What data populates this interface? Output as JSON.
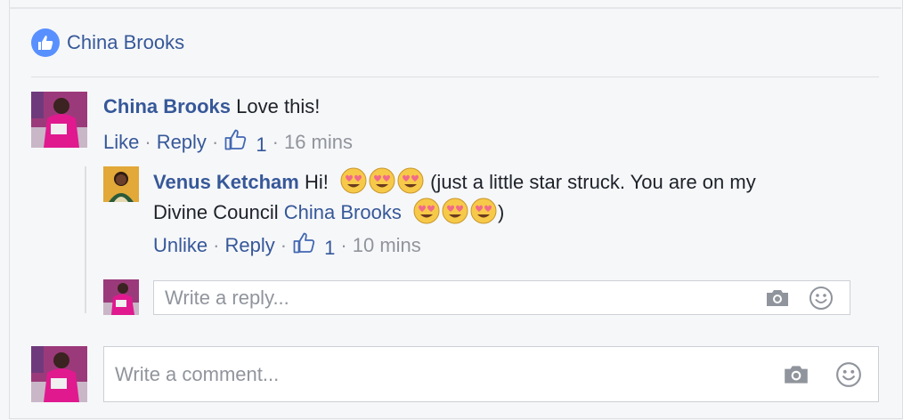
{
  "likes_summary": {
    "name": "China Brooks"
  },
  "comments": [
    {
      "author": "China Brooks",
      "text": "Love this!",
      "actions": {
        "like": "Like",
        "reply": "Reply",
        "like_count": "1",
        "time": "16 mins"
      }
    }
  ],
  "reply": {
    "author": "Venus Ketcham",
    "text_part1": "Hi!",
    "text_part2": "(just a little star struck. You are on my",
    "text_part3": "Divine Council",
    "mention": "China Brooks",
    "text_part4": ")",
    "emoji": "smiling-face-with-heart-eyes",
    "actions": {
      "unlike": "Unlike",
      "reply": "Reply",
      "like_count": "1",
      "time": "10 mins"
    }
  },
  "reply_input": {
    "placeholder": "Write a reply..."
  },
  "comment_input": {
    "placeholder": "Write a comment..."
  },
  "separator": "·",
  "colors": {
    "link": "#365899",
    "meta": "#90949c",
    "like_blue": "#5890ff",
    "background": "#f6f7f9"
  },
  "icons": [
    "thumbs-up-icon",
    "camera-icon",
    "smiley-icon"
  ]
}
